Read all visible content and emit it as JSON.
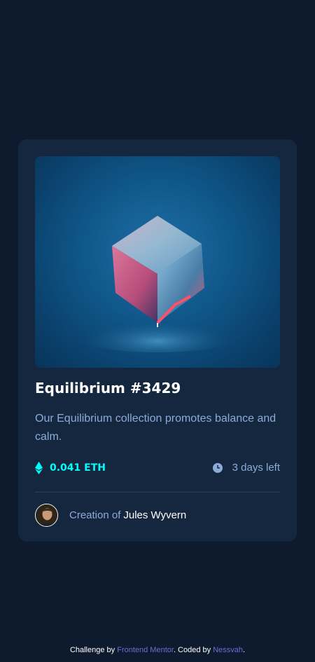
{
  "card": {
    "title": "Equilibrium #3429",
    "description": "Our Equilibrium collection promotes balance and calm.",
    "price": "0.041 ETH",
    "time_left": "3 days left",
    "creation_label": "Creation of",
    "creator_name": "Jules Wyvern",
    "image_name": "equilibrium-cube-image",
    "icons": {
      "price": "ethereum-icon",
      "time": "clock-icon"
    }
  },
  "footer": {
    "challenge_text": "Challenge by",
    "challenge_link": "Frontend Mentor",
    "coded_text": ". Coded by",
    "author_link": "Nessvah",
    "end": "."
  },
  "colors": {
    "background": "#0e1a2d",
    "card": "#15263f",
    "accent": "#00fff8",
    "soft_blue": "#8bacd9",
    "link": "#6b6fd4",
    "white": "#ffffff"
  }
}
